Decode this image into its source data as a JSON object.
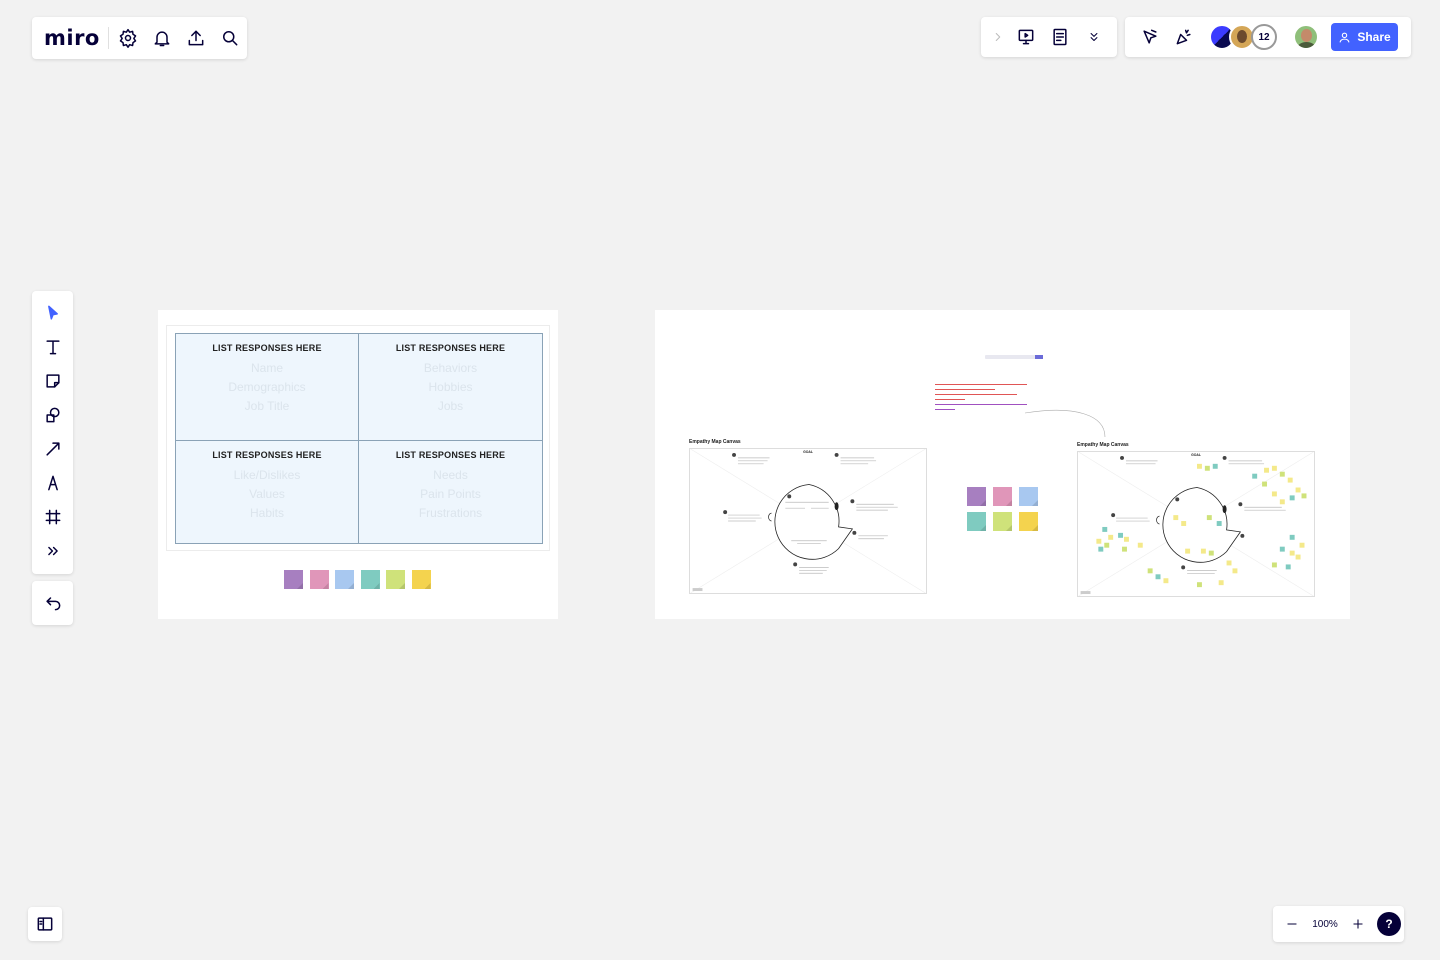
{
  "app": {
    "logo": "miro"
  },
  "top_left_toolbar": {
    "icons": [
      "settings-icon",
      "bell-icon",
      "upload-icon",
      "search-icon"
    ]
  },
  "top_right_toolbar": {
    "collaborators_count": "12",
    "share_label": "Share"
  },
  "left_toolbar": {
    "tools": [
      "select-tool",
      "text-tool",
      "sticky-note-tool",
      "shapes-tool",
      "arrow-tool",
      "pen-tool",
      "frame-tool",
      "more-tools"
    ]
  },
  "zoom": {
    "level": "100%",
    "help": "?"
  },
  "board1": {
    "quadrants": [
      {
        "heading": "LIST RESPONSES HERE",
        "placeholders": [
          "Name",
          "Demographics",
          "Job Title"
        ]
      },
      {
        "heading": "LIST RESPONSES HERE",
        "placeholders": [
          "Behaviors",
          "Hobbies",
          "Jobs"
        ]
      },
      {
        "heading": "LIST RESPONSES HERE",
        "placeholders": [
          "Like/Dislikes",
          "Values",
          "Habits"
        ]
      },
      {
        "heading": "LIST RESPONSES HERE",
        "placeholders": [
          "Needs",
          "Pain Points",
          "Frustrations"
        ]
      }
    ],
    "sticky_colors": [
      "#a77fc0",
      "#e096b9",
      "#a8c8f0",
      "#7fcbc0",
      "#cfe27a",
      "#f4d34e"
    ]
  },
  "board2": {
    "canvas_left_title": "Empathy Map Canvas",
    "canvas_right_title": "Empathy Map Canvas",
    "goal_label": "GOAL",
    "sticky_colors": [
      "#a77fc0",
      "#e096b9",
      "#a8c8f0",
      "#7fcbc0",
      "#cfe27a",
      "#f4d34e"
    ],
    "colors": {
      "accent": "#4262ff",
      "note_red": "#e05555",
      "note_purple": "#a050c0"
    }
  }
}
